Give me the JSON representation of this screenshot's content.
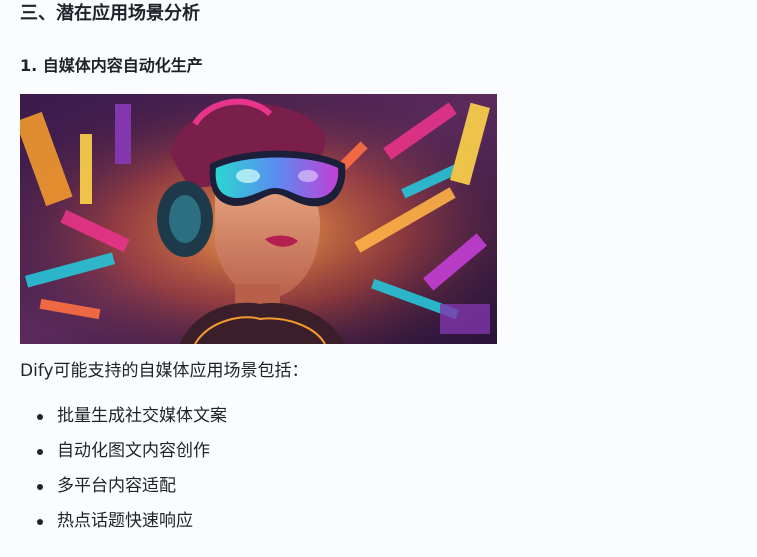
{
  "section": {
    "heading": "三、潜在应用场景分析",
    "subheading": "1. 自媒体内容自动化生产",
    "image": {
      "subject": "cyberpunk-woman-vr-goggles-headphones"
    },
    "paragraph": "Dify可能支持的自媒体应用场景包括：",
    "items": [
      "批量生成社交媒体文案",
      "自动化图文内容创作",
      "多平台内容适配",
      "热点话题快速响应"
    ]
  }
}
